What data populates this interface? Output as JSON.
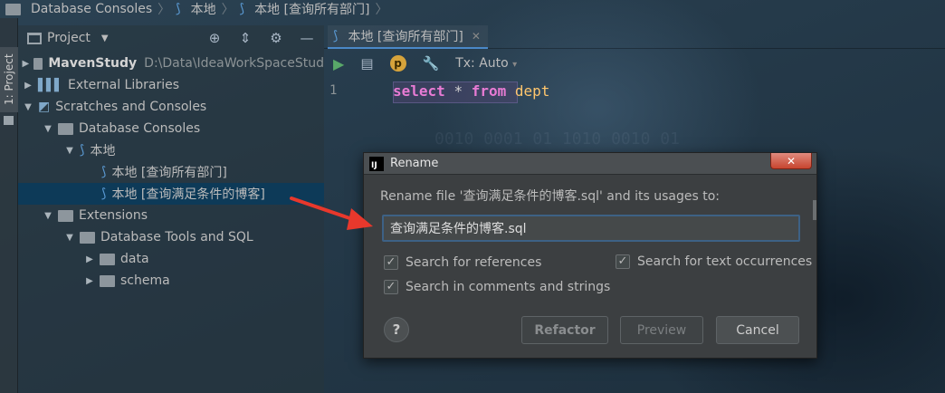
{
  "breadcrumb": {
    "items": [
      "Database Consoles",
      "本地",
      "本地 [查询所有部门]"
    ]
  },
  "stripe": {
    "project_tab": "1: Project"
  },
  "project": {
    "title": "Project",
    "tree": [
      {
        "label": "MavenStudy",
        "path": "D:\\Data\\IdeaWorkSpaceStud"
      },
      {
        "label": "External Libraries"
      },
      {
        "label": "Scratches and Consoles"
      },
      {
        "label": "Database Consoles"
      },
      {
        "label": "本地"
      },
      {
        "label": "本地 [查询所有部门]"
      },
      {
        "label": "本地 [查询满足条件的博客]"
      },
      {
        "label": "Extensions"
      },
      {
        "label": "Database Tools and SQL"
      },
      {
        "label": "data"
      },
      {
        "label": "schema"
      }
    ]
  },
  "editor": {
    "tab_label": "本地 [查询所有部门]",
    "tx_label": "Tx: Auto",
    "line_number": "1",
    "code": {
      "kw1": "select",
      "op": "*",
      "kw2": "from",
      "table": "dept"
    }
  },
  "dialog": {
    "title": "Rename",
    "message": "Rename file '查询满足条件的博客.sql' and its usages to:",
    "input_value": "查询满足条件的博客.sql",
    "checkboxes": {
      "references": "Search for references",
      "text": "Search for text occurrences",
      "comments": "Search in comments and strings"
    },
    "help": "?",
    "buttons": {
      "refactor": "Refactor",
      "preview": "Preview",
      "cancel": "Cancel"
    }
  },
  "colors": {
    "accent_selection": "#0d3a58",
    "keyword": "#e87bd4",
    "table_name": "#ffc66d",
    "annotation_arrow": "#e8382c"
  }
}
